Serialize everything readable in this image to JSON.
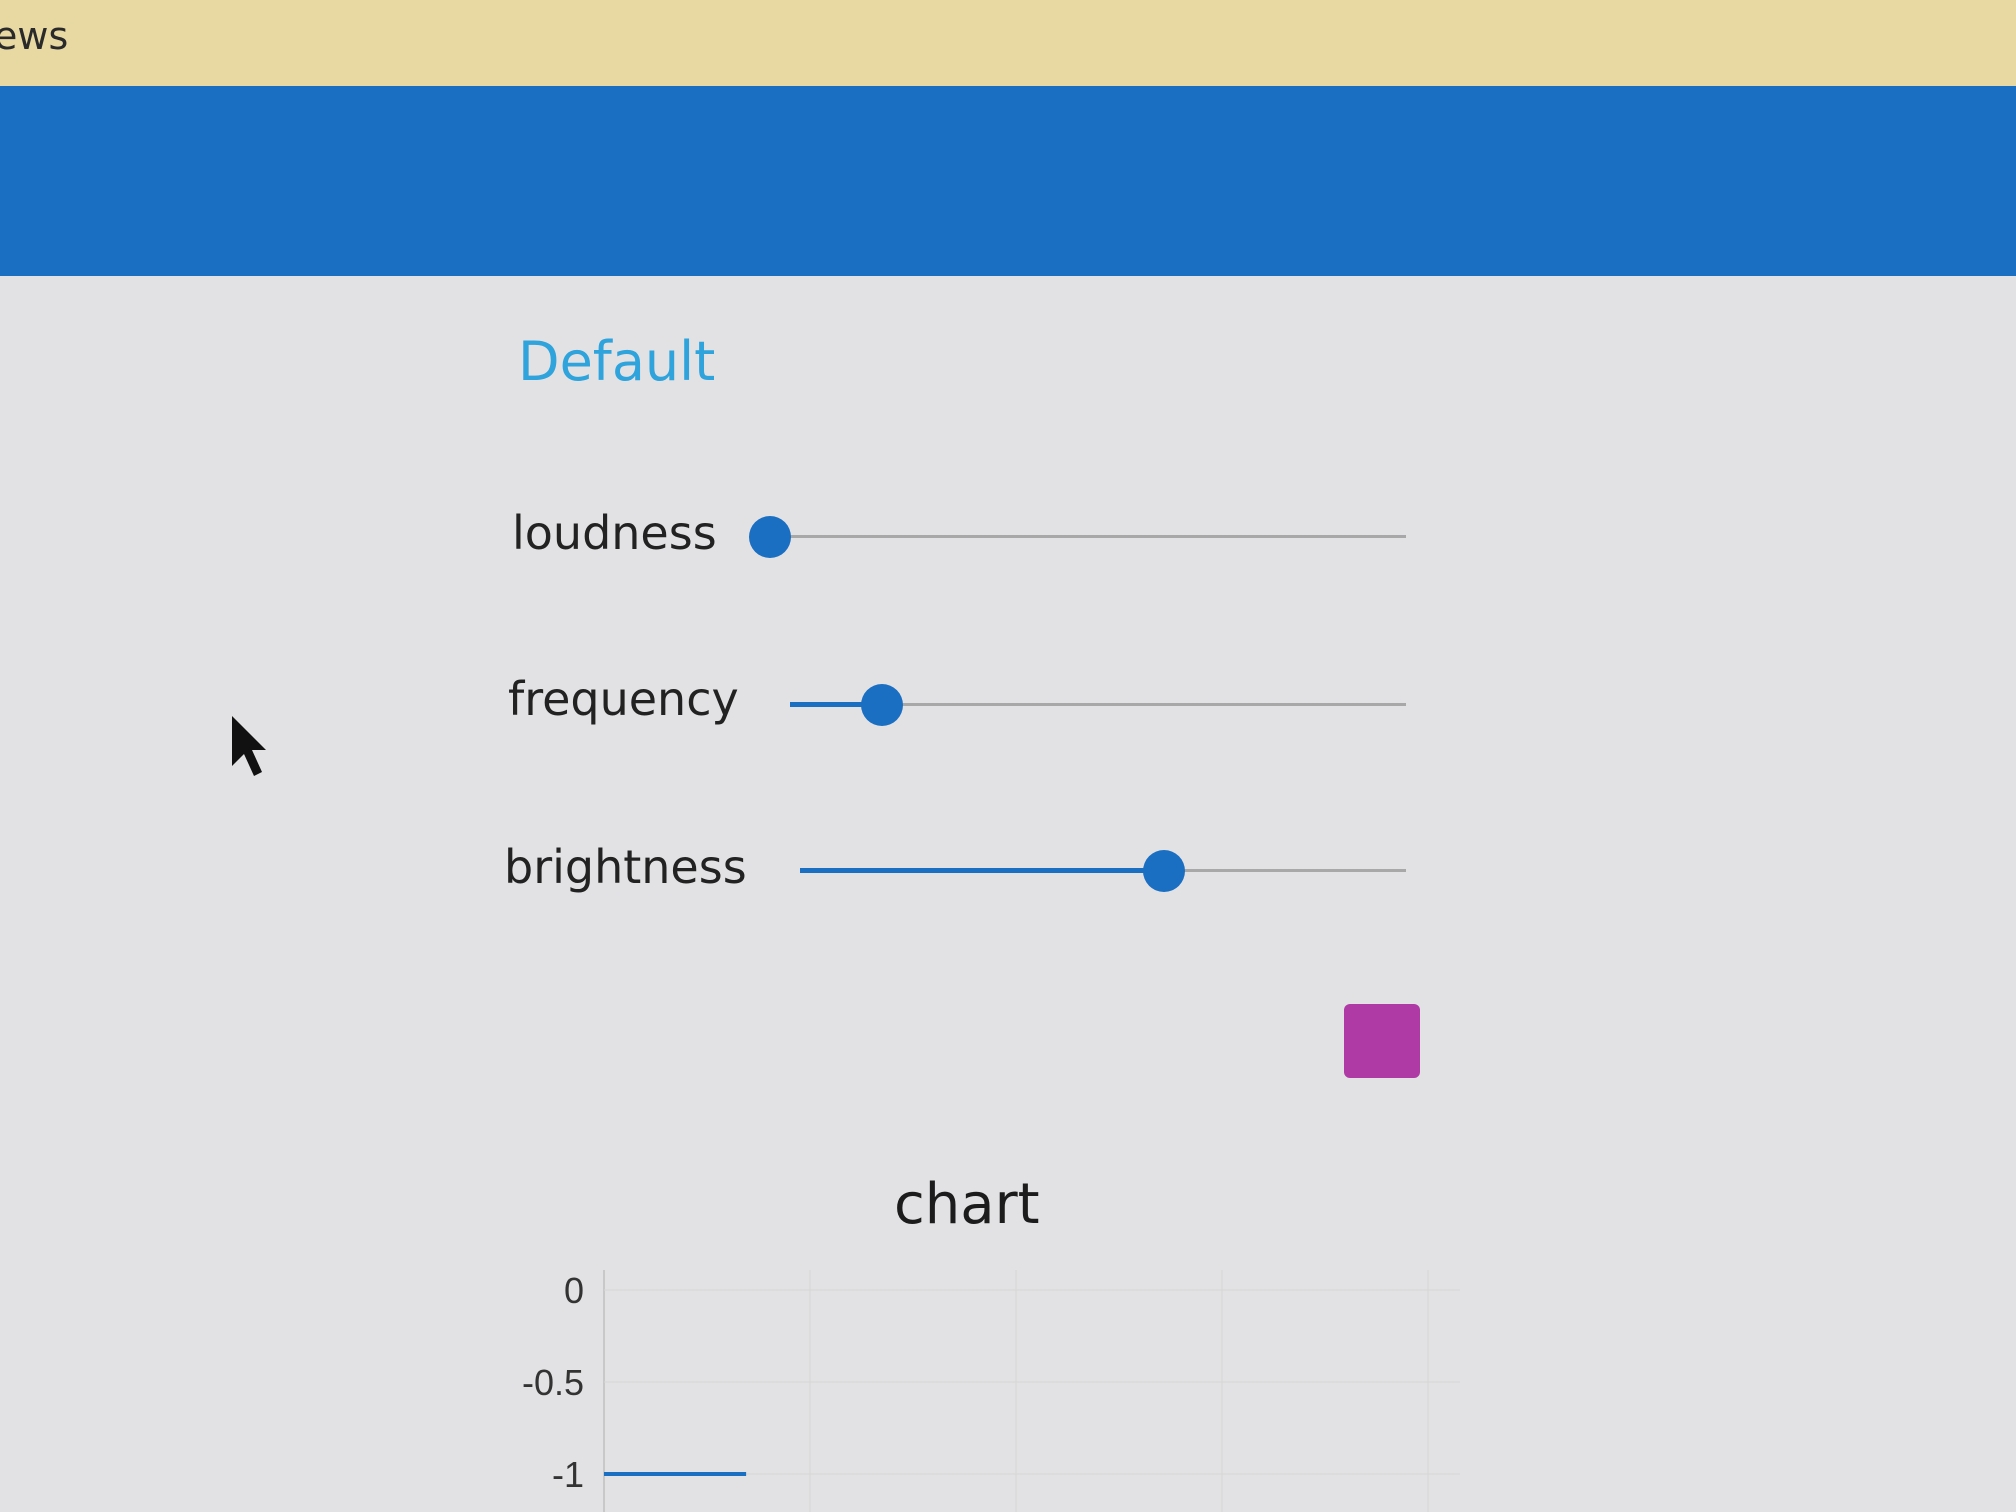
{
  "window": {
    "title": "ews"
  },
  "section": {
    "title": "Default"
  },
  "sliders": [
    {
      "label": "loudness",
      "value": 0.0
    },
    {
      "label": "frequency",
      "value": 0.15
    },
    {
      "label": "brightness",
      "value": 0.6
    }
  ],
  "swatch": {
    "color": "#b03aa5"
  },
  "colors": {
    "header": "#1a6fc2",
    "accent": "#2fa3dc",
    "slider": "#1a6fc2"
  },
  "chart": {
    "title": "chart",
    "chart_data": {
      "type": "line",
      "title": "chart",
      "y_ticks": [
        "0",
        "-0.5",
        "-1"
      ],
      "ylim": [
        -1,
        0
      ],
      "grid": true,
      "series": [
        {
          "x": [
            0,
            0.17
          ],
          "values": [
            -1,
            -1
          ]
        }
      ]
    }
  }
}
